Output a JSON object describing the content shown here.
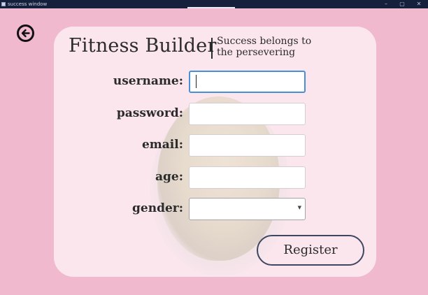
{
  "window": {
    "title": "success window",
    "minimize_glyph": "–",
    "maximize_glyph": "▢",
    "close_glyph": "✕"
  },
  "header": {
    "app_title": "Fitness Builder",
    "slogan": "Success belongs to the persevering"
  },
  "form": {
    "fields": [
      {
        "label": "username:",
        "value": "",
        "focused": true
      },
      {
        "label": "password:",
        "value": ""
      },
      {
        "label": "email:",
        "value": ""
      },
      {
        "label": "age:",
        "value": ""
      }
    ],
    "gender": {
      "label": "gender:",
      "value": ""
    },
    "register_label": "Register"
  },
  "icons": {
    "back": "arrow-left-circle-icon",
    "dropdown": "chevron-down-icon"
  },
  "colors": {
    "background": "#f0b9cd",
    "titlebar": "#15203d",
    "card": "#fcecf2",
    "focus_ring": "#4a8fd6",
    "text": "#2b2b2b"
  }
}
